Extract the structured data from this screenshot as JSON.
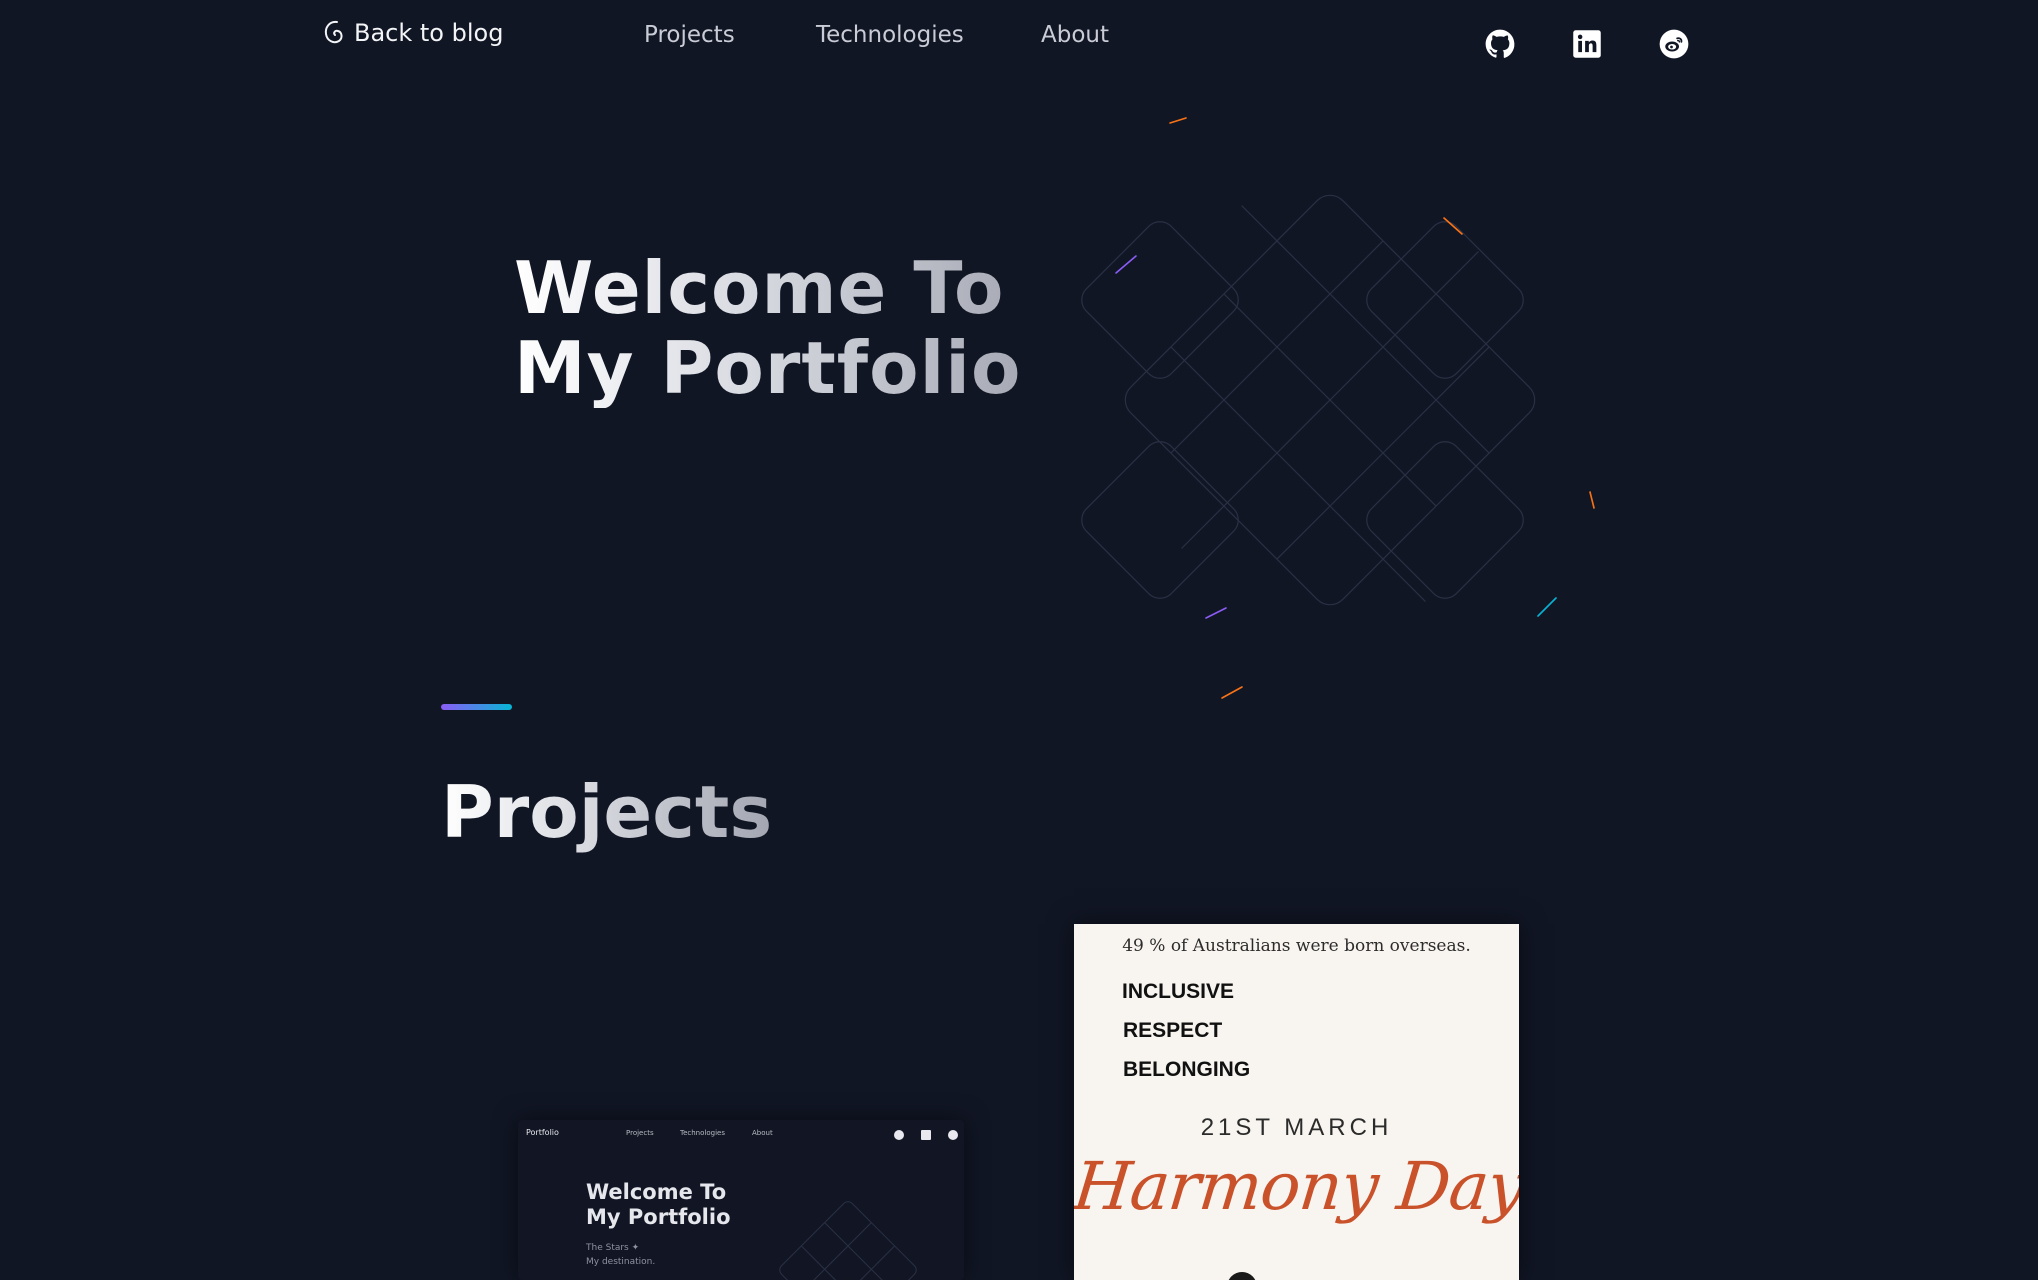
{
  "nav": {
    "back_label": "Back to blog",
    "links": [
      "Projects",
      "Technologies",
      "About"
    ],
    "social": [
      "github-icon",
      "linkedin-icon",
      "weibo-icon"
    ]
  },
  "hero": {
    "title_line1": "Welcome To",
    "title_line2": "My Portfolio"
  },
  "projects": {
    "heading": "Projects",
    "portfolio_card": {
      "logo": "Portfolio",
      "nav": [
        "Projects",
        "Technologies",
        "About"
      ],
      "title_line1": "Welcome To",
      "title_line2": "My Portfolio",
      "sub_line1": "The Stars ✦",
      "sub_line2": "My destination."
    },
    "poster_card": {
      "stat": "49 % of Australians were born overseas.",
      "words": [
        "INCLUSIVE",
        "RESPECT",
        "BELONGING"
      ],
      "date": "21ST MARCH",
      "script": "Harmony Day"
    }
  },
  "colors": {
    "background": "#111625",
    "accent_start": "#8b5cf6",
    "accent_end": "#06b6d4",
    "poster_orange": "#c9522b"
  }
}
